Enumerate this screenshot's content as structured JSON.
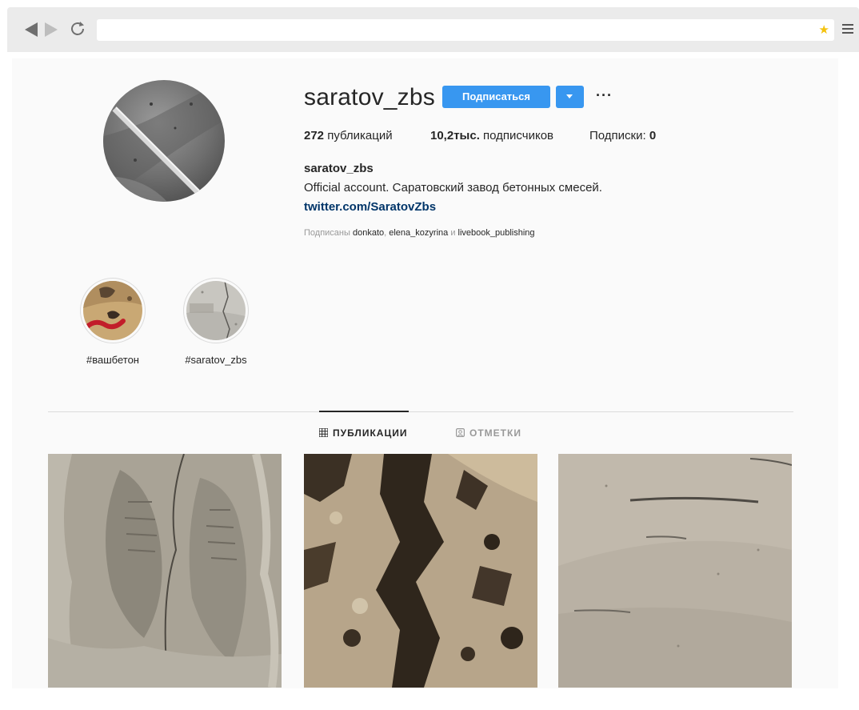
{
  "browser": {
    "address": "",
    "icons": [
      "back-icon",
      "forward-icon",
      "reload-icon",
      "star-icon",
      "menu-icon"
    ]
  },
  "profile": {
    "username": "saratov_zbs",
    "follow_label": "Подписаться",
    "more_label": "···",
    "stats": {
      "posts_count": "272",
      "posts_label": "публикаций",
      "followers_count": "10,2тыс.",
      "followers_label": "подписчиков",
      "following_label": "Подписки:",
      "following_count": "0"
    },
    "bio": {
      "name": "saratov_zbs",
      "text": "Official account. Саратовский завод бетонных смесей.",
      "link": "twitter.com/SaratovZbs"
    },
    "followed_by": {
      "prefix": "Подписаны",
      "users": [
        "donkato",
        "elena_kozyrina",
        "livebook_publishing"
      ],
      "separator": ",",
      "conjunction": "и"
    }
  },
  "highlights": [
    {
      "label": "#вашбетон"
    },
    {
      "label": "#saratov_zbs"
    }
  ],
  "tabs": [
    {
      "label": "ПУБЛИКАЦИИ",
      "active": true
    },
    {
      "label": "ОТМЕТКИ",
      "active": false
    }
  ],
  "colors": {
    "accent": "#3897f0",
    "link": "#003569",
    "page_bg": "#fafafa"
  }
}
